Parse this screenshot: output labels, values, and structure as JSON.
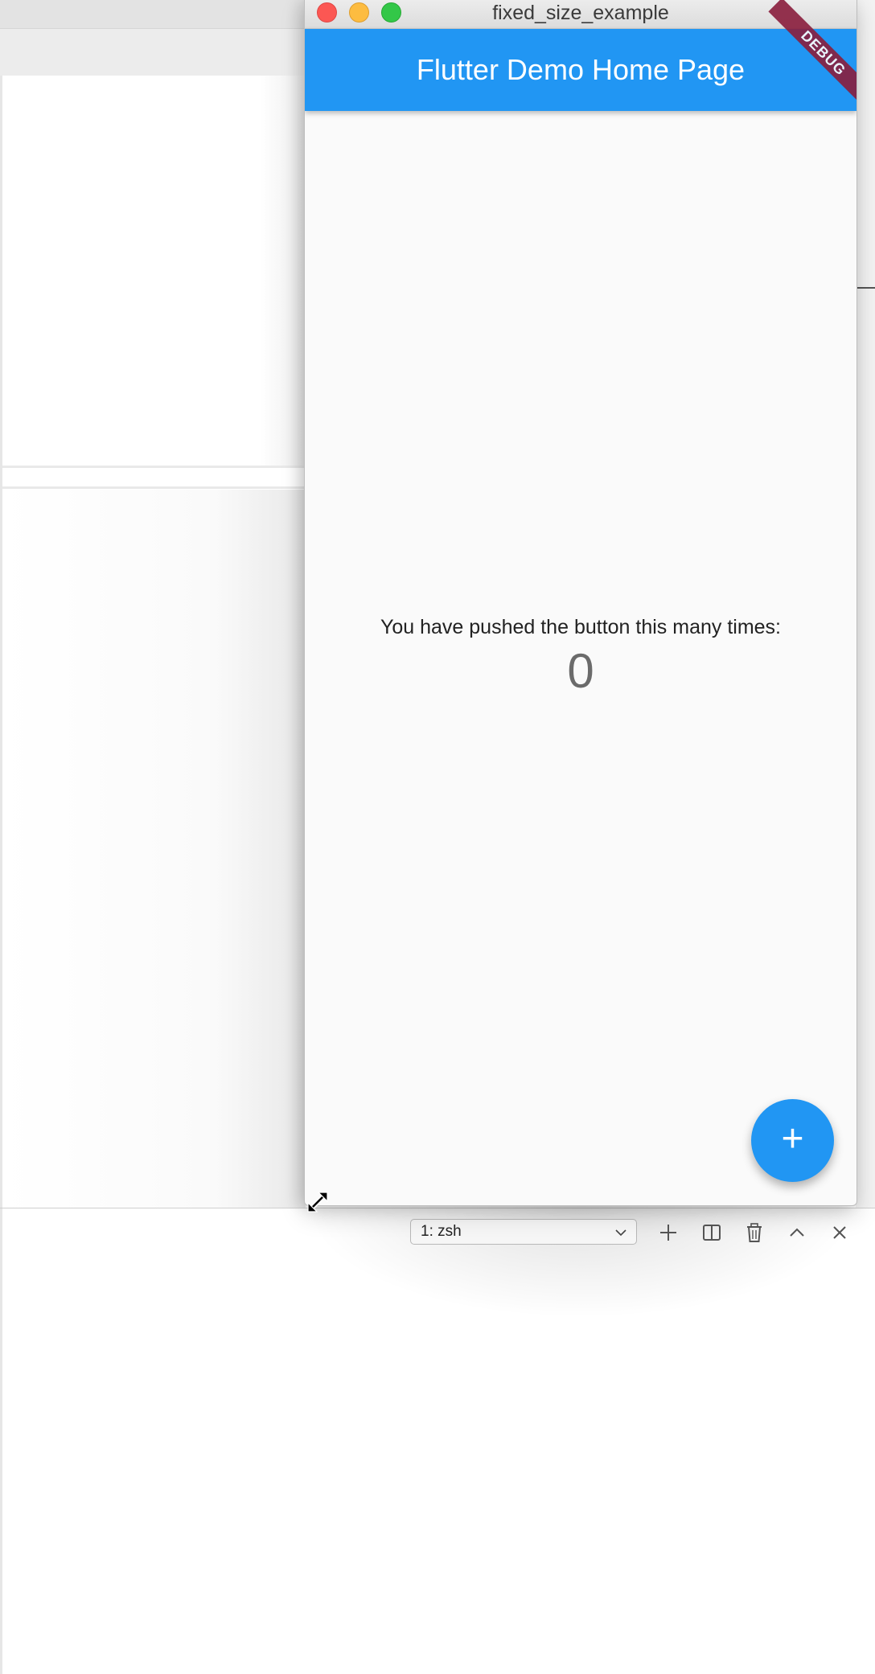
{
  "window": {
    "title": "fixed_size_example"
  },
  "app": {
    "appbar_title": "Flutter Demo Home Page",
    "debug_banner": "DEBUG",
    "body_text": "You have pushed the button this many times:",
    "counter": "0",
    "fab_label": "+",
    "fab_icon": "add-icon"
  },
  "terminal": {
    "selected_terminal": "1: zsh",
    "icons": [
      "add-terminal-icon",
      "split-terminal-icon",
      "trash-icon",
      "maximize-panel-icon",
      "close-panel-icon"
    ]
  },
  "colors": {
    "primary": "#2196f3",
    "debug": "#8a1e3d",
    "close": "#fc5753",
    "minimize": "#fdbc40",
    "zoom": "#33c748"
  }
}
